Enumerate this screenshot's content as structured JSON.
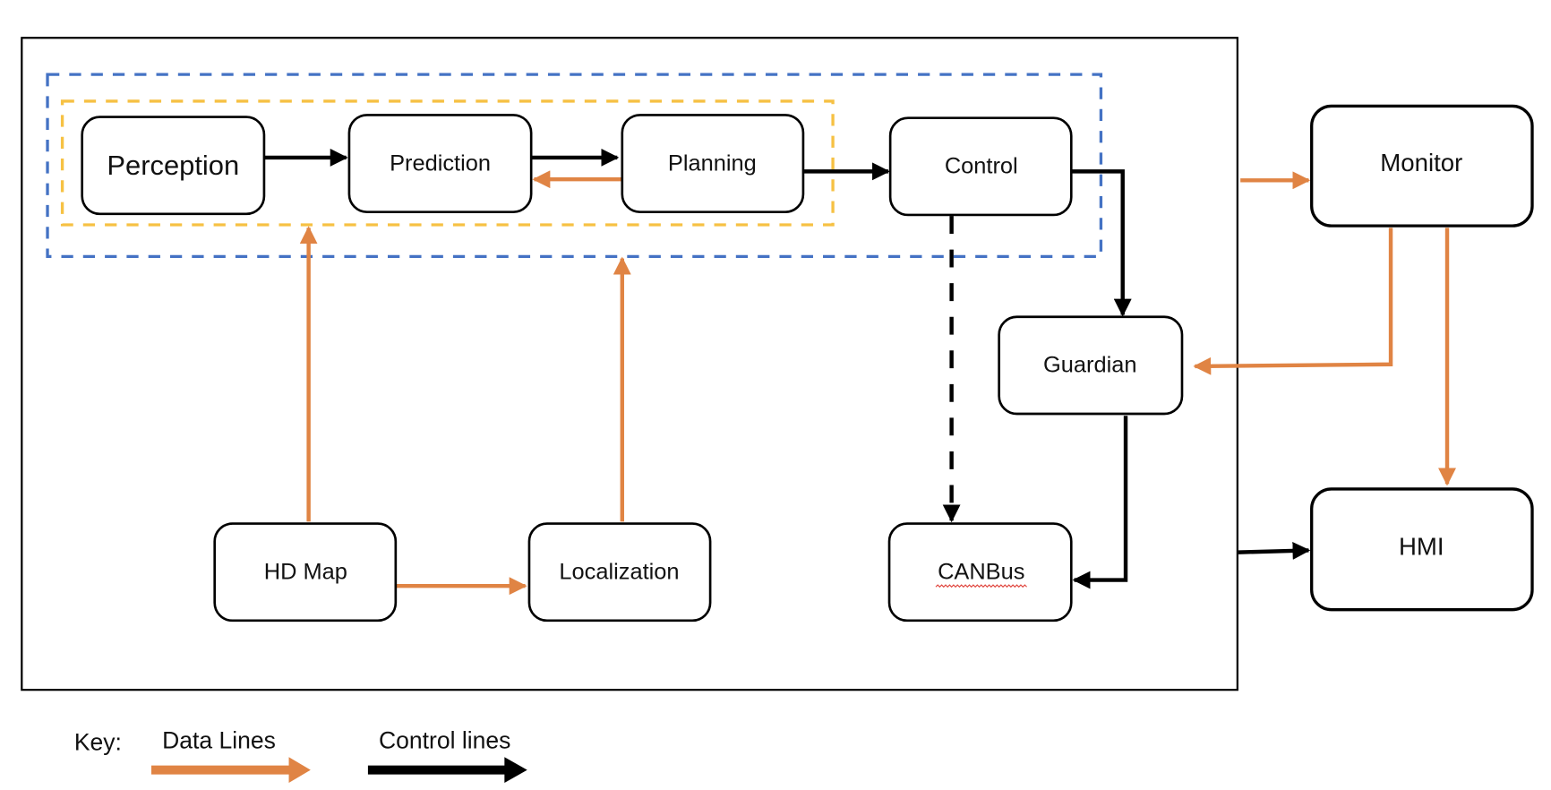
{
  "colors": {
    "data_line": "#E08444",
    "control_line": "#000000",
    "group_outer": "#4472C4",
    "group_inner": "#F6C143"
  },
  "nodes": {
    "perception": "Perception",
    "prediction": "Prediction",
    "planning": "Planning",
    "control": "Control",
    "guardian": "Guardian",
    "hdmap": "HD Map",
    "localization": "Localization",
    "canbus": "CANBus",
    "monitor": "Monitor",
    "hmi": "HMI"
  },
  "edges": [
    {
      "from": "Perception",
      "to": "Prediction",
      "type": "control"
    },
    {
      "from": "Prediction",
      "to": "Planning",
      "type": "control"
    },
    {
      "from": "Planning",
      "to": "Prediction",
      "type": "data"
    },
    {
      "from": "Planning",
      "to": "Control",
      "type": "control"
    },
    {
      "from": "Control",
      "to": "Guardian",
      "type": "control"
    },
    {
      "from": "Control",
      "to": "CANBus",
      "type": "control",
      "style": "dashed"
    },
    {
      "from": "Guardian",
      "to": "CANBus",
      "type": "control"
    },
    {
      "from": "HD Map",
      "to": "Localization",
      "type": "data"
    },
    {
      "from": "HD Map",
      "to": "Perception/Prediction group",
      "type": "data"
    },
    {
      "from": "Localization",
      "to": "Planning group",
      "type": "data"
    },
    {
      "from": "System",
      "to": "Monitor",
      "type": "data"
    },
    {
      "from": "Monitor",
      "to": "Guardian",
      "type": "data"
    },
    {
      "from": "Monitor",
      "to": "HMI",
      "type": "data"
    },
    {
      "from": "System",
      "to": "HMI",
      "type": "control"
    }
  ],
  "key": {
    "title": "Key:",
    "data_label": "Data Lines",
    "control_label": "Control lines"
  }
}
